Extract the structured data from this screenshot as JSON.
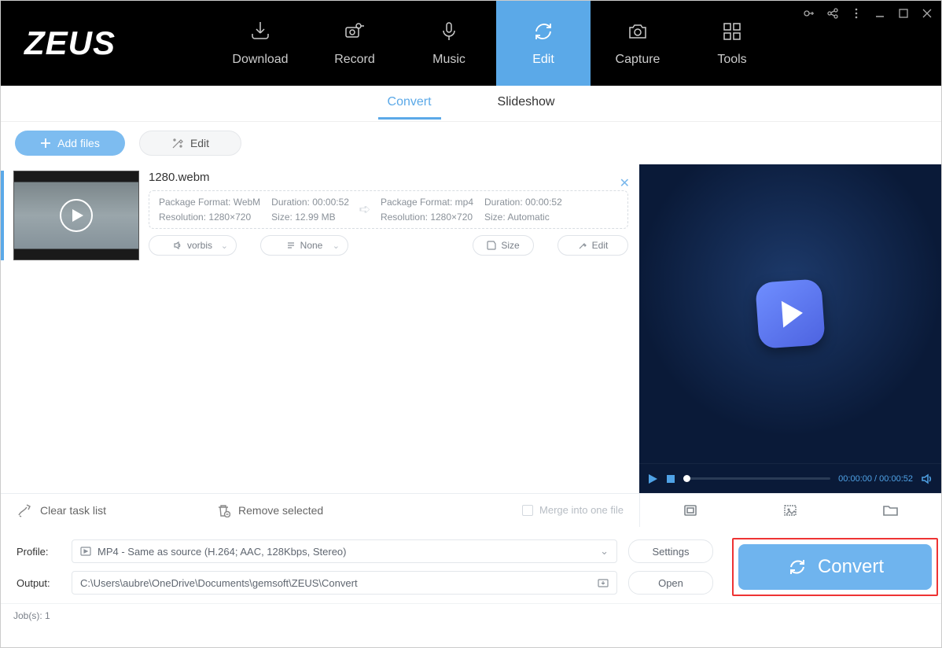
{
  "app": {
    "name": "ZEUS"
  },
  "nav": {
    "items": [
      {
        "label": "Download"
      },
      {
        "label": "Record"
      },
      {
        "label": "Music"
      },
      {
        "label": "Edit"
      },
      {
        "label": "Capture"
      },
      {
        "label": "Tools"
      }
    ]
  },
  "subtabs": {
    "convert": "Convert",
    "slideshow": "Slideshow"
  },
  "toolbar": {
    "add_files": "Add files",
    "edit": "Edit"
  },
  "file": {
    "name": "1280.webm",
    "src": {
      "package_format_label": "Package Format:",
      "package_format": "WebM",
      "resolution_label": "Resolution:",
      "resolution": "1280×720",
      "duration_label": "Duration:",
      "duration": "00:00:52",
      "size_label": "Size:",
      "size": "12.99 MB"
    },
    "dst": {
      "package_format_label": "Package Format:",
      "package_format": "mp4",
      "resolution_label": "Resolution:",
      "resolution": "1280×720",
      "duration_label": "Duration:",
      "duration": "00:00:52",
      "size_label": "Size:",
      "size": "Automatic"
    },
    "audio_codec": "vorbis",
    "subtitle": "None",
    "size_btn": "Size",
    "edit_btn": "Edit"
  },
  "player": {
    "time_current": "00:00:00",
    "time_sep": " / ",
    "time_total": "00:00:52"
  },
  "strip": {
    "clear": "Clear task list",
    "remove": "Remove selected",
    "merge": "Merge into one file"
  },
  "form": {
    "profile_label": "Profile:",
    "profile_value": "MP4 - Same as source (H.264; AAC, 128Kbps, Stereo)",
    "output_label": "Output:",
    "output_value": "C:\\Users\\aubre\\OneDrive\\Documents\\gemsoft\\ZEUS\\Convert",
    "settings": "Settings",
    "open": "Open",
    "convert": "Convert"
  },
  "status": {
    "jobs_label": "Job(s):",
    "jobs_count": "1"
  }
}
